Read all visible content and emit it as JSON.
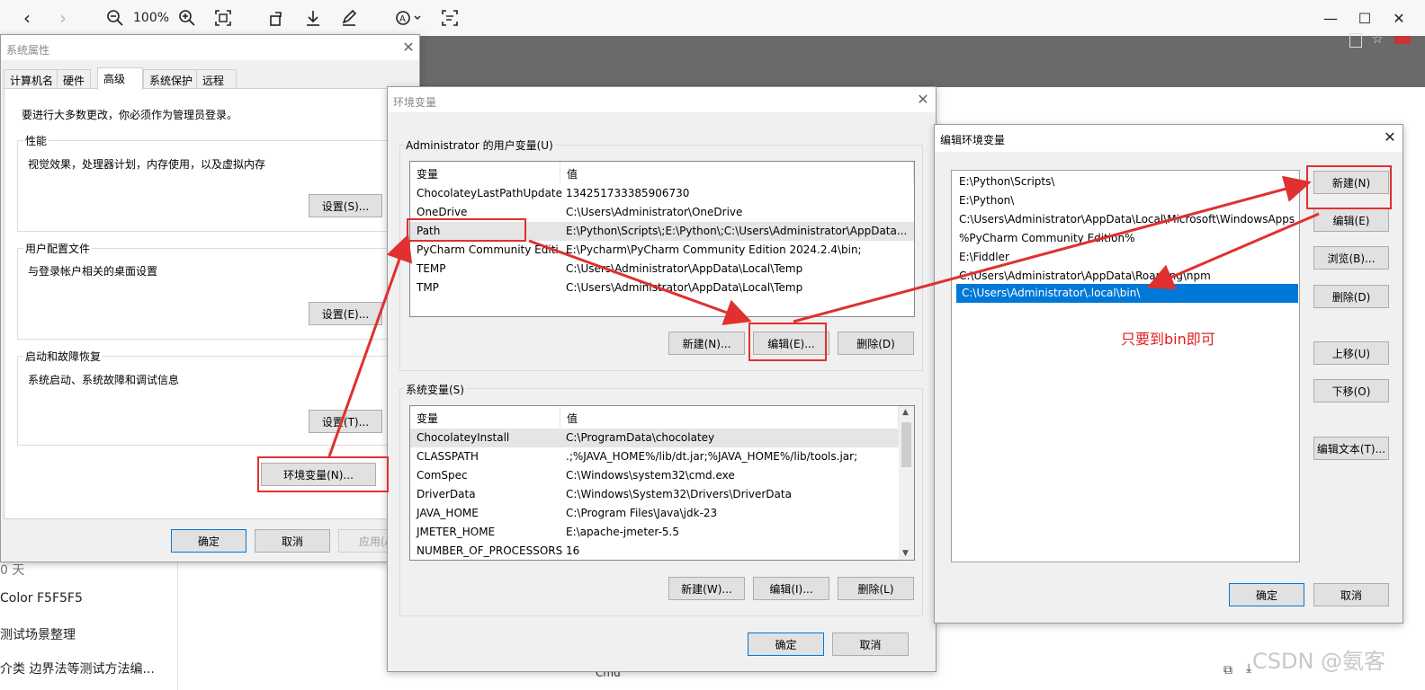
{
  "viewer": {
    "zoom": "100%"
  },
  "background": {
    "items": [
      "0 天",
      "Color F5F5F5",
      "测试场景整理",
      "介类 边界法等测试方法编..."
    ],
    "bottom_text": "Cmd"
  },
  "sys_props": {
    "title": "系统属性",
    "tabs": [
      "计算机名",
      "硬件",
      "高级",
      "系统保护",
      "远程"
    ],
    "admin_note": "要进行大多数更改，你必须作为管理员登录。",
    "perf": {
      "label": "性能",
      "desc": "视觉效果，处理器计划，内存使用，以及虚拟内存",
      "button": "设置(S)..."
    },
    "profile": {
      "label": "用户配置文件",
      "desc": "与登录帐户相关的桌面设置",
      "button": "设置(E)..."
    },
    "startup": {
      "label": "启动和故障恢复",
      "desc": "系统启动、系统故障和调试信息",
      "button": "设置(T)..."
    },
    "env_button": "环境变量(N)...",
    "ok": "确定",
    "cancel": "取消",
    "apply": "应用(A)"
  },
  "env_vars": {
    "title": "环境变量",
    "user_group": "Administrator 的用户变量(U)",
    "sys_group": "系统变量(S)",
    "col_var": "变量",
    "col_val": "值",
    "user_rows": [
      {
        "name": "ChocolateyLastPathUpdate",
        "value": "134251733385906730"
      },
      {
        "name": "OneDrive",
        "value": "C:\\Users\\Administrator\\OneDrive"
      },
      {
        "name": "Path",
        "value": "E:\\Python\\Scripts\\;E:\\Python\\;C:\\Users\\Administrator\\AppData..."
      },
      {
        "name": "PyCharm Community Editi...",
        "value": "E:\\Pycharm\\PyCharm Community Edition 2024.2.4\\bin;"
      },
      {
        "name": "TEMP",
        "value": "C:\\Users\\Administrator\\AppData\\Local\\Temp"
      },
      {
        "name": "TMP",
        "value": "C:\\Users\\Administrator\\AppData\\Local\\Temp"
      }
    ],
    "sys_rows": [
      {
        "name": "ChocolateyInstall",
        "value": "C:\\ProgramData\\chocolatey"
      },
      {
        "name": "CLASSPATH",
        "value": ".;%JAVA_HOME%/lib/dt.jar;%JAVA_HOME%/lib/tools.jar;"
      },
      {
        "name": "ComSpec",
        "value": "C:\\Windows\\system32\\cmd.exe"
      },
      {
        "name": "DriverData",
        "value": "C:\\Windows\\System32\\Drivers\\DriverData"
      },
      {
        "name": "JAVA_HOME",
        "value": "C:\\Program Files\\Java\\jdk-23"
      },
      {
        "name": "JMETER_HOME",
        "value": "E:\\apache-jmeter-5.5"
      },
      {
        "name": "NUMBER_OF_PROCESSORS",
        "value": "16"
      }
    ],
    "user_buttons": {
      "new": "新建(N)...",
      "edit": "编辑(E)...",
      "delete": "删除(D)"
    },
    "sys_buttons": {
      "new": "新建(W)...",
      "edit": "编辑(I)...",
      "delete": "删除(L)"
    },
    "ok": "确定",
    "cancel": "取消"
  },
  "edit_env": {
    "title": "编辑环境变量",
    "entries": [
      "E:\\Python\\Scripts\\",
      "E:\\Python\\",
      "C:\\Users\\Administrator\\AppData\\Local\\Microsoft\\WindowsApps",
      "%PyCharm Community Edition%",
      "E:\\Fiddler",
      "C:\\Users\\Administrator\\AppData\\Roaming\\npm",
      "C:\\Users\\Administrator\\.local\\bin\\"
    ],
    "buttons": {
      "new": "新建(N)",
      "edit": "编辑(E)",
      "browse": "浏览(B)...",
      "delete": "删除(D)",
      "up": "上移(U)",
      "down": "下移(O)",
      "edit_text": "编辑文本(T)..."
    },
    "ok": "确定",
    "cancel": "取消"
  },
  "annotation": {
    "note": "只要到bin即可",
    "color": "#e03030"
  },
  "watermark": "CSDN @氨客"
}
